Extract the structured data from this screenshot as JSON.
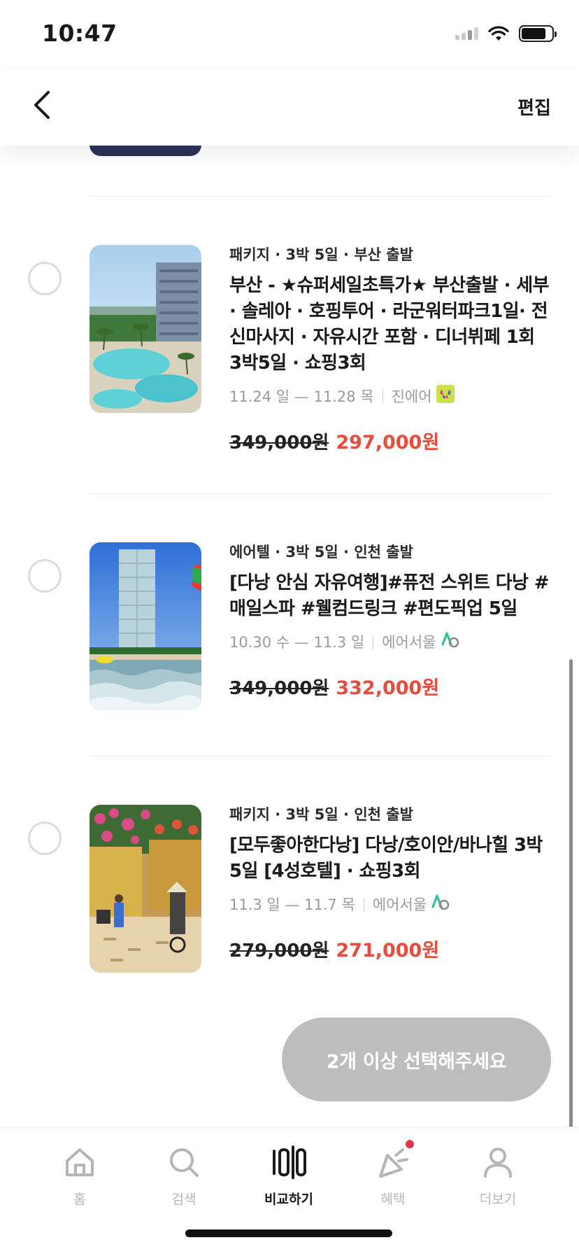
{
  "status_bar": {
    "time": "10:47"
  },
  "nav": {
    "edit_label": "편집"
  },
  "items": [
    {
      "meta": "패키지 · 3박  5일 · 부산 출발",
      "title": "부산 - ★슈퍼세일초특가★ 부산출발 · 세부 · 솔레아 · 호핑투어 · 라군워터파크1일· 전신마사지 · 자유시간 포함 · 디너뷔페 1회 3박5일  · 쇼핑3회",
      "dates": "11.24 일 — 11.28 목",
      "airline": "진에어",
      "original_price": "349,000원",
      "sale_price": "297,000원",
      "thumbnail_icon": "resort-pool-photo",
      "airline_icon": "jinair-logo-icon"
    },
    {
      "meta": "에어텔 · 3박  5일 · 인천 출발",
      "title": "[다낭 안심 자유여행]#퓨전 스위트 다낭 #매일스파 #웰컴드링크 #편도픽업 5일",
      "dates": "10.30 수 — 11.3 일",
      "airline": "에어서울",
      "original_price": "349,000원",
      "sale_price": "332,000원",
      "thumbnail_icon": "beach-hotel-photo",
      "airline_icon": "airseoul-logo-icon"
    },
    {
      "meta": "패키지 · 3박  5일 · 인천 출발",
      "title": "[모두좋아한다낭] 다낭/호이안/바나힐 3박5일 [4성호텔]  · 쇼핑3회",
      "dates": "11.3 일 — 11.7 목",
      "airline": "에어서울",
      "original_price": "279,000원",
      "sale_price": "271,000원",
      "thumbnail_icon": "hoian-street-photo",
      "airline_icon": "airseoul-logo-icon"
    }
  ],
  "cta": {
    "label": "2개 이상 선택해주세요"
  },
  "tabs": [
    {
      "label": "홈",
      "icon": "home-icon"
    },
    {
      "label": "검색",
      "icon": "search-icon"
    },
    {
      "label": "비교하기",
      "icon": "compare-icon"
    },
    {
      "label": "혜택",
      "icon": "party-popper-icon"
    },
    {
      "label": "더보기",
      "icon": "person-icon"
    }
  ],
  "colors": {
    "sale": "#e74c3c",
    "cta_disabled": "#bdbdbd",
    "notification": "#e8344a"
  }
}
